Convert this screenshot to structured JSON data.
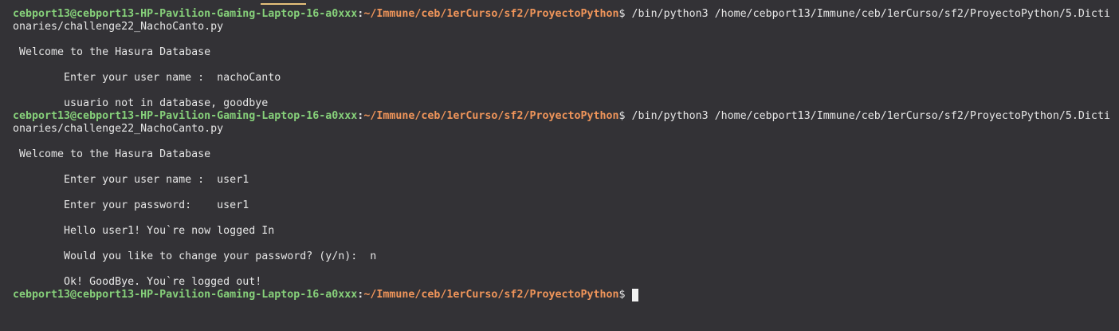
{
  "prompt": {
    "user_host": "cebport13@cebport13-HP-Pavilion-Gaming-Laptop-16-a0xxx",
    "separator": ":",
    "path": "~/Immune/ceb/1erCurso/sf2/ProyectoPython",
    "symbol": "$ "
  },
  "run1": {
    "command_line1": "/bin/python3 /home/cebport13/Immune/ceb/1erCurso/sf2/ProyectoPython/5.Dicti",
    "command_line2": "onaries/challenge22_NachoCanto.py",
    "welcome": " Welcome to the Hasura Database",
    "username_prompt": "        Enter your user name :  nachoCanto",
    "result": "        usuario not in database, goodbye"
  },
  "run2": {
    "command_line1": "/bin/python3 /home/cebport13/Immune/ceb/1erCurso/sf2/ProyectoPython/5.Dicti",
    "command_line2": "onaries/challenge22_NachoCanto.py",
    "welcome": " Welcome to the Hasura Database",
    "username_prompt": "        Enter your user name :  user1",
    "password_prompt": "        Enter your password:    user1",
    "hello": "        Hello user1! You`re now logged In",
    "change_password": "        Would you like to change your password? (y/n):  n",
    "goodbye": "        Ok! GoodBye. You`re logged out!"
  },
  "colors": {
    "background": "#333236",
    "prompt_user": "#86d07a",
    "prompt_path": "#f0955a",
    "text": "#e6e6e6"
  }
}
